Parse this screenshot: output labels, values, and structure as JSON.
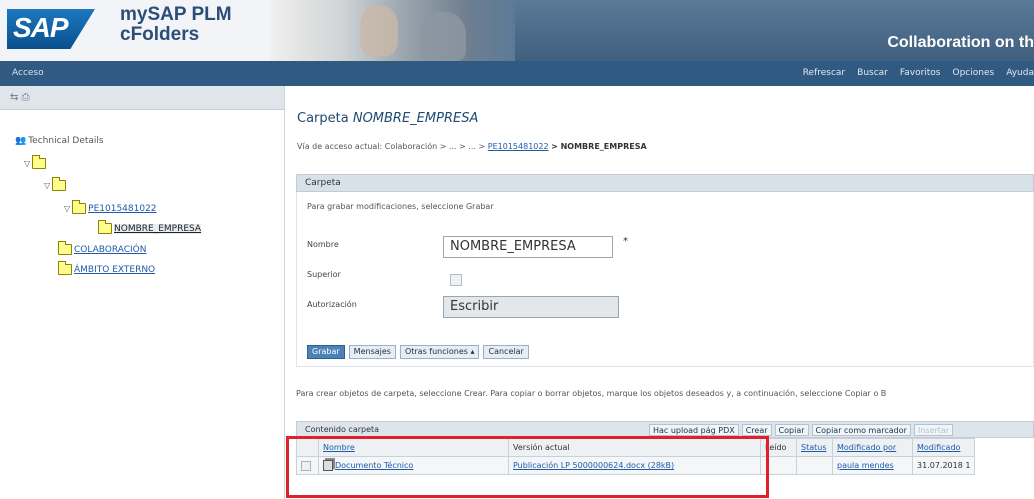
{
  "header": {
    "logo_text": "SAP",
    "app_title": "mySAP PLM",
    "app_subtitle": "cFolders",
    "banner": "Collaboration on th"
  },
  "menubar": {
    "left": "Acceso",
    "items": [
      "Refrescar",
      "Buscar",
      "Favoritos",
      "Opciones",
      "Ayuda"
    ]
  },
  "sidebar": {
    "tools": "⇆ ⎙",
    "root": "Technical Details",
    "nodes": [
      {
        "label": ""
      },
      {
        "label": ""
      },
      {
        "label": "PE1015481022"
      },
      {
        "label": "NOMBRE_EMPRESA"
      },
      {
        "label": "COLABORACIÓN"
      },
      {
        "label": "ÁMBITO EXTERNO"
      }
    ]
  },
  "main": {
    "title_prefix": "Carpeta",
    "title_name": "NOMBRE_EMPRESA",
    "breadcrumb_label": "Vía de acceso actual:",
    "breadcrumb_path": "Colaboración > ... > ... >",
    "breadcrumb_link": "PE1015481022",
    "breadcrumb_current": "> NOMBRE_EMPRESA",
    "section_title": "Carpeta",
    "hint": "Para grabar modificaciones, seleccione Grabar",
    "fields": {
      "nombre_label": "Nombre",
      "nombre_value": "NOMBRE_EMPRESA",
      "required": "*",
      "superior_label": "Superior",
      "autorizacion_label": "Autorización",
      "autorizacion_value": "Escribir"
    },
    "buttons": [
      "Grabar",
      "Mensajes",
      "Otras funciones ▴",
      "Cancelar"
    ],
    "instructions": "Para crear objetos de carpeta, seleccione Crear. Para copiar o borrar objetos, marque los objetos deseados y, a continuación, seleccione Copiar o B",
    "table": {
      "title": "Contenido carpeta",
      "toolbar": [
        "Hac upload pág PDX",
        "Crear",
        "Copiar",
        "Copiar como marcador",
        "Insertar"
      ],
      "headers": [
        "Nombre",
        "Versión actual",
        "Leído",
        "Status",
        "Modificado por",
        "Modificado"
      ],
      "rows": [
        [
          "Documento Técnico",
          "Publicación LP 5000000624.docx (28kB)",
          "",
          "",
          "paula mendes",
          "31.07.2018 1"
        ]
      ]
    }
  }
}
